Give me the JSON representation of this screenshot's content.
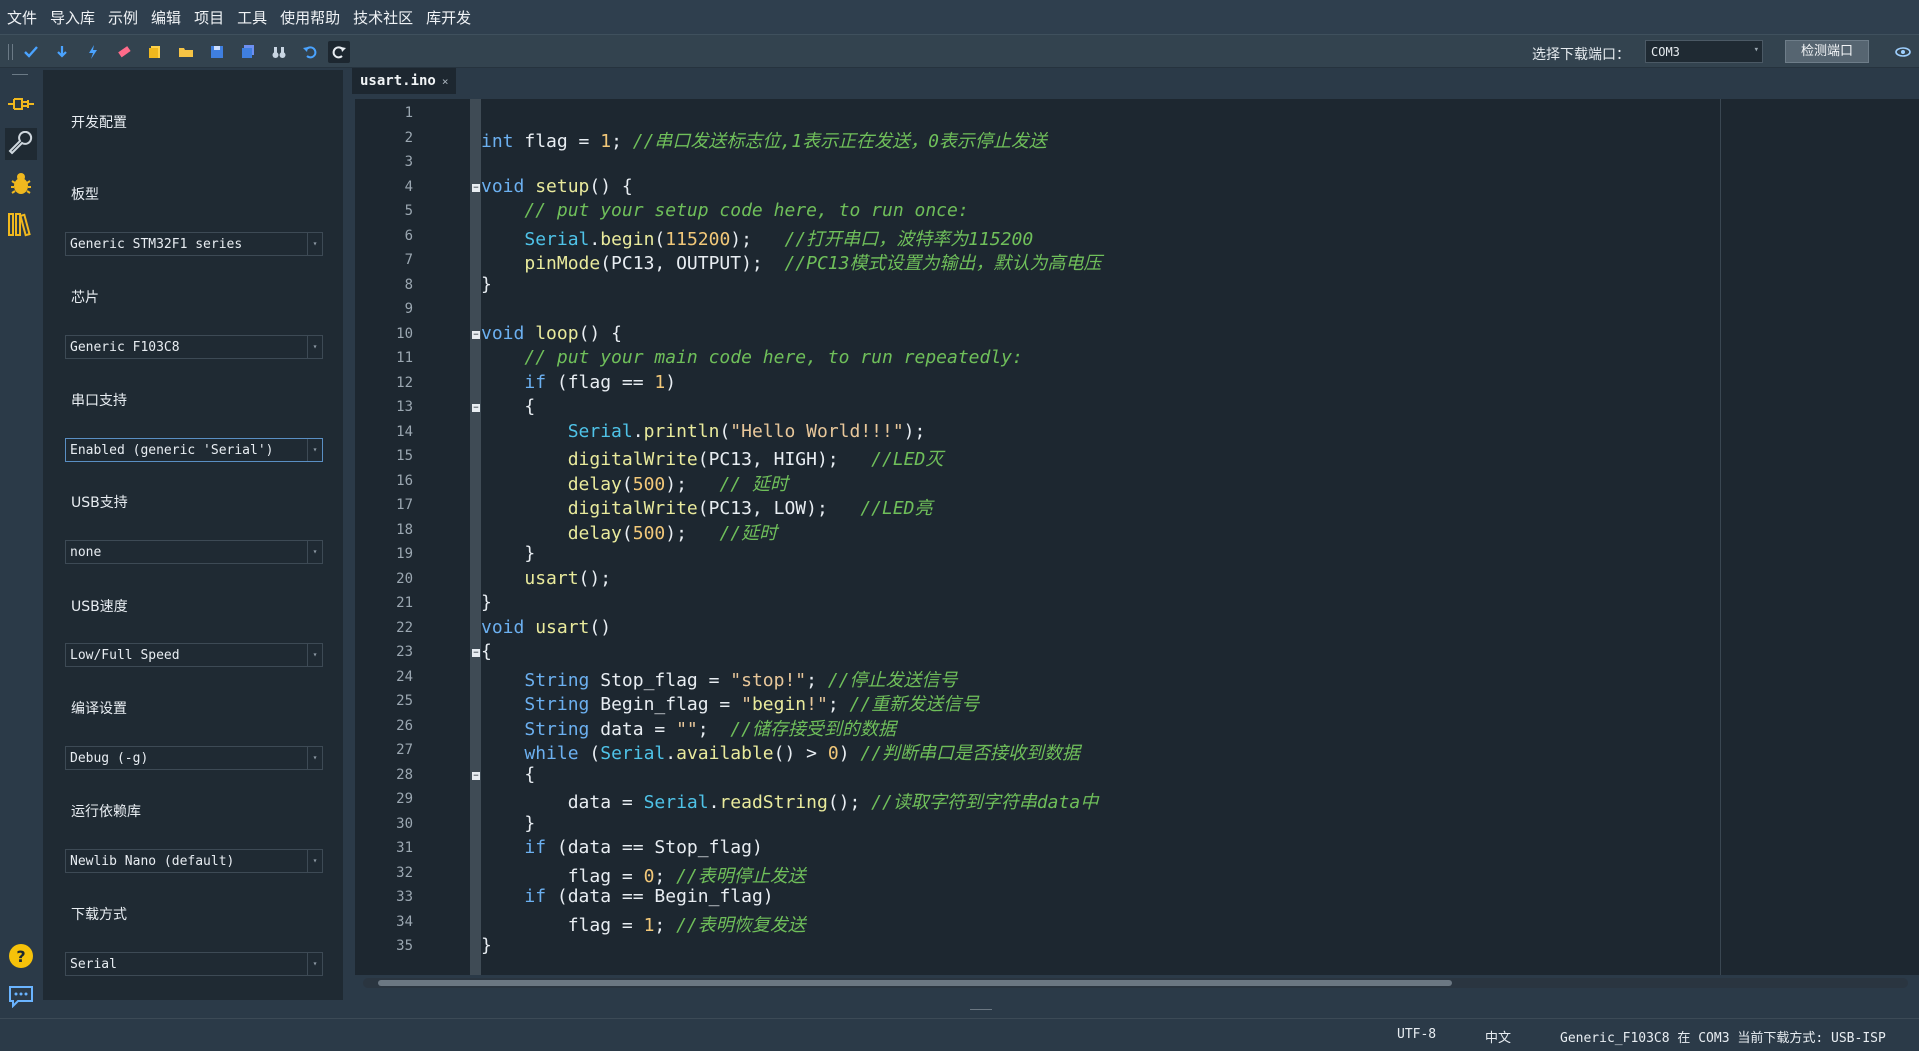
{
  "menu": [
    "文件",
    "导入库",
    "示例",
    "编辑",
    "项目",
    "工具",
    "使用帮助",
    "技术社区",
    "库开发"
  ],
  "toolbar": {
    "icons": [
      "verify-icon",
      "upload-icon",
      "flash-icon",
      "erase-icon",
      "new-file-icon",
      "open-folder-icon",
      "save-icon",
      "save-all-icon",
      "find-icon",
      "undo-icon",
      "redo-icon"
    ],
    "port_label": "选择下载端口：",
    "port_value": "COM3",
    "detect_button": "检测端口"
  },
  "config": {
    "title": "开发配置",
    "items": [
      {
        "label": "板型",
        "value": "Generic STM32F1 series"
      },
      {
        "label": "芯片",
        "value": "Generic F103C8"
      },
      {
        "label": "串口支持",
        "value": "Enabled (generic 'Serial')"
      },
      {
        "label": "USB支持",
        "value": "none"
      },
      {
        "label": "USB速度",
        "value": "Low/Full Speed"
      },
      {
        "label": "编译设置",
        "value": "Debug (-g)"
      },
      {
        "label": "运行依赖库",
        "value": "Newlib Nano (default)"
      },
      {
        "label": "下载方式",
        "value": "Serial"
      }
    ]
  },
  "editor": {
    "tab": "usart.ino",
    "tab_close": "×",
    "lines": [
      "",
      "int flag = 1; //串口发送标志位,1表示正在发送，0表示停止发送",
      "",
      "void setup() {",
      "    // put your setup code here, to run once:",
      "    Serial.begin(115200);   //打开串口，波特率为115200",
      "    pinMode(PC13, OUTPUT);  //PC13模式设置为输出，默认为高电压",
      "}",
      "",
      "void loop() {",
      "    // put your main code here, to run repeatedly:",
      "    if (flag == 1)",
      "    {",
      "        Serial.println(\"Hello World!!!\");",
      "        digitalWrite(PC13, HIGH);   //LED灭",
      "        delay(500);   // 延时",
      "        digitalWrite(PC13, LOW);   //LED亮",
      "        delay(500);   //延时",
      "    }",
      "    usart();",
      "}",
      "void usart()",
      "{",
      "    String Stop_flag = \"stop!\"; //停止发送信号",
      "    String Begin_flag = \"begin!\"; //重新发送信号",
      "    String data = \"\";  //储存接受到的数据",
      "    while (Serial.available() > 0) //判断串口是否接收到数据",
      "    {",
      "        data = Serial.readString(); //读取字符到字符串data中",
      "    }",
      "    if (data == Stop_flag)",
      "        flag = 0; //表明停止发送",
      "    if (data == Begin_flag)",
      "        flag = 1; //表明恢复发送",
      "}"
    ]
  },
  "status": {
    "encoding": "UTF-8",
    "language": "中文",
    "info": "Generic_F103C8 在 COM3 当前下载方式: USB-ISP"
  }
}
